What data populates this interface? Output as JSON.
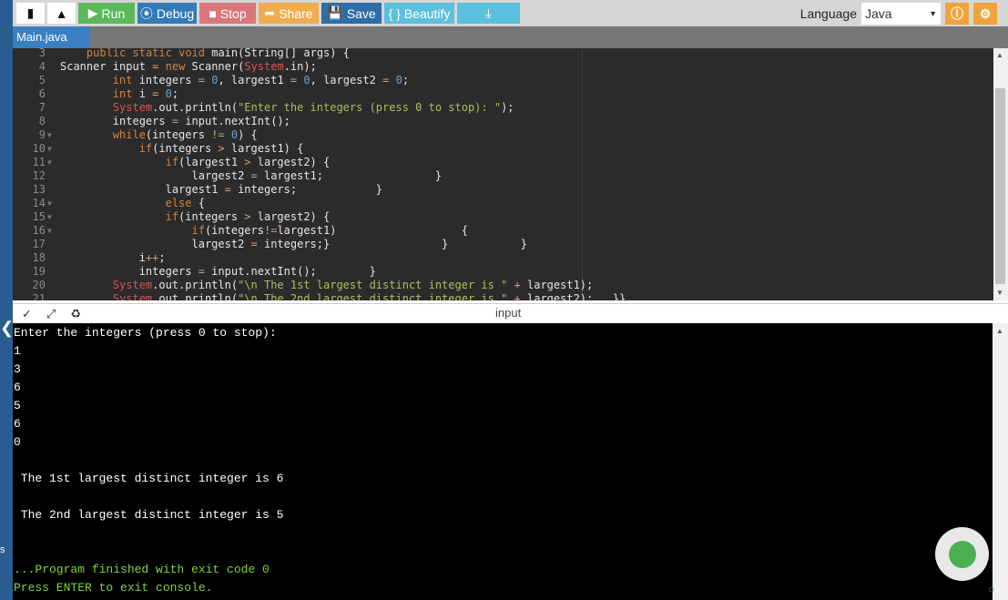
{
  "toolbar": {
    "new_file": "new-file",
    "upload": "upload",
    "run": "Run",
    "debug": "Debug",
    "stop": "Stop",
    "share": "Share",
    "save": "Save",
    "beautify": "{ } Beautify",
    "language_label": "Language",
    "language_value": "Java",
    "colors": {
      "run": "#5cb85c",
      "debug": "#337ab7",
      "stop": "#d9534f",
      "share": "#f0ad4e",
      "save": "#337ab7",
      "beautify": "#5bc0de",
      "download": "#5bc0de"
    }
  },
  "tabs": [
    {
      "label": "Main.java"
    }
  ],
  "editor": {
    "first_line": 3,
    "lines": [
      "    public static void main(String[] args) {",
      "Scanner input = new Scanner(System.in);",
      "        int integers = 0, largest1 = 0, largest2 = 0;",
      "        int i = 0;",
      "        System.out.println(\"Enter the integers (press 0 to stop): \");",
      "        integers = input.nextInt();",
      "        while(integers != 0) {",
      "            if(integers > largest1) {",
      "                if(largest1 > largest2) {",
      "                    largest2 = largest1;                 }",
      "                largest1 = integers;            }",
      "                else {",
      "                if(integers > largest2) {",
      "                    if(integers!=largest1)                   {",
      "                    largest2 = integers;}                 }           }",
      "            i++;",
      "            integers = input.nextInt();        }",
      "        System.out.println(\"\\n The 1st largest distinct integer is \" + largest1);",
      "        System.out.println(\"\\n The 2nd largest distinct integer is \" + largest2);   }}"
    ],
    "fold_lines": [
      9,
      10,
      11,
      14,
      15,
      16
    ]
  },
  "console": {
    "header_label": "input",
    "output": [
      {
        "text": "Enter the integers (press 0 to stop):",
        "green": false
      },
      {
        "text": "1",
        "green": false
      },
      {
        "text": "3",
        "green": false
      },
      {
        "text": "6",
        "green": false
      },
      {
        "text": "5",
        "green": false
      },
      {
        "text": "6",
        "green": false
      },
      {
        "text": "0",
        "green": false
      },
      {
        "text": "",
        "green": false
      },
      {
        "text": " The 1st largest distinct integer is 6",
        "green": false
      },
      {
        "text": "",
        "green": false
      },
      {
        "text": " The 2nd largest distinct integer is 5",
        "green": false
      },
      {
        "text": "",
        "green": false
      },
      {
        "text": "",
        "green": false
      },
      {
        "text": "...Program finished with exit code 0",
        "green": true
      },
      {
        "text": "Press ENTER to exit console.",
        "green": true
      }
    ]
  }
}
